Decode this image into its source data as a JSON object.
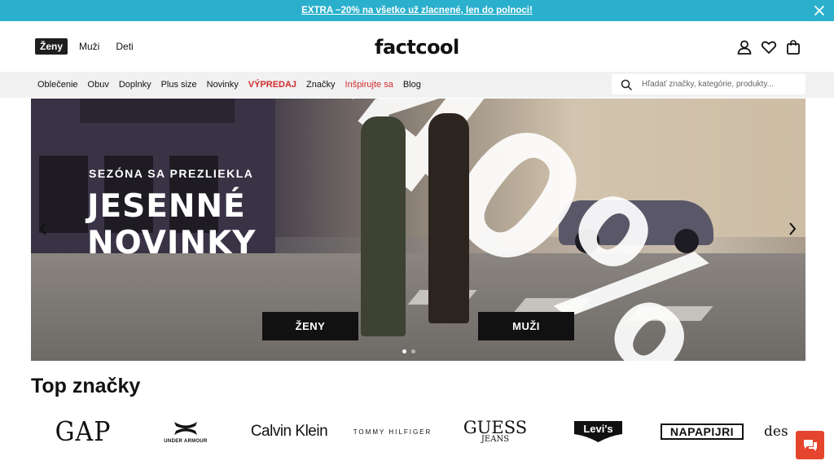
{
  "promo": {
    "text": "EXTRA −20% na všetko už zlacnené, len do polnoci!",
    "close_icon": "close-icon",
    "background": "#2ab0cc"
  },
  "header": {
    "gender_tabs": [
      {
        "label": "Ženy",
        "active": true
      },
      {
        "label": "Muži",
        "active": false
      },
      {
        "label": "Deti",
        "active": false
      }
    ],
    "logo": "factcool",
    "icons": [
      "user-icon",
      "heart-icon",
      "bag-icon"
    ]
  },
  "nav": {
    "items": [
      {
        "label": "Oblečenie"
      },
      {
        "label": "Obuv"
      },
      {
        "label": "Doplnky"
      },
      {
        "label": "Plus size"
      },
      {
        "label": "Novinky"
      },
      {
        "label": "VÝPREDAJ"
      },
      {
        "label": "Značky"
      },
      {
        "label": "Inšpirujte sa"
      },
      {
        "label": "Blog"
      }
    ],
    "accent": "#d22d2d"
  },
  "search": {
    "placeholder": "Hľadať značky, kategórie, produkty...",
    "icon": "search-icon"
  },
  "hero": {
    "subtitle": "SEZÓNA SA PREZLIEKLA",
    "title": "JESENNÉ\nNOVINKY",
    "big_text": "-40%",
    "buttons": [
      {
        "label": "ŽENY"
      },
      {
        "label": "MUŽI"
      }
    ],
    "slides_count": 2,
    "active_slide": 0
  },
  "brands": {
    "title": "Top značky",
    "items": [
      {
        "name": "GAP"
      },
      {
        "name": "UNDER ARMOUR"
      },
      {
        "name": "Calvin Klein"
      },
      {
        "name": "TOMMY HILFIGER"
      },
      {
        "name": "GUESS",
        "sub": "JEANS"
      },
      {
        "name": "Levi's"
      },
      {
        "name": "NAPAPIJRI"
      },
      {
        "name": "des"
      }
    ]
  },
  "chat": {
    "icon": "chat-icon",
    "color": "#e5452d"
  }
}
